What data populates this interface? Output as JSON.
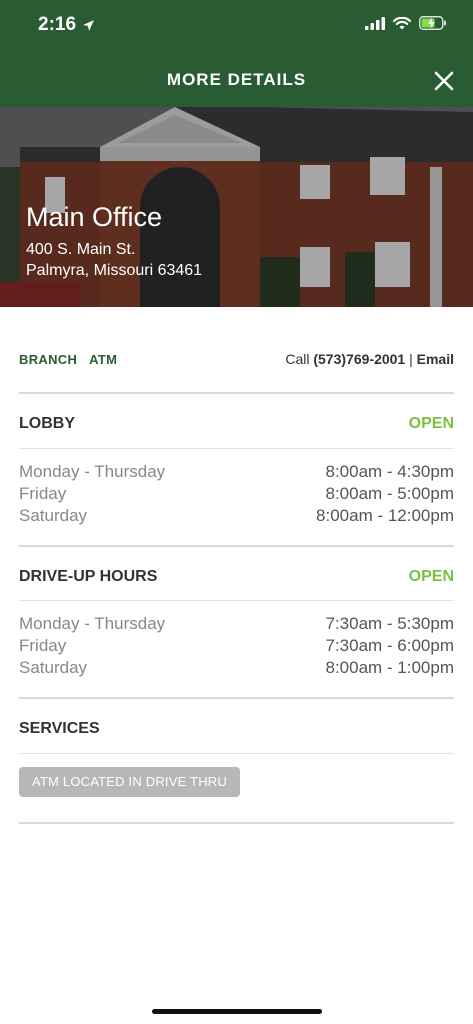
{
  "status": {
    "time": "2:16"
  },
  "nav": {
    "title": "MORE DETAILS"
  },
  "branch": {
    "name": "Main Office",
    "address_line1": "400 S. Main St.",
    "address_line2": "Palmyra, Missouri 63461"
  },
  "tabs": [
    "BRANCH",
    "ATM"
  ],
  "contact": {
    "call_label": "Call",
    "phone": "(573)769-2001",
    "separator": "|",
    "email_label": "Email"
  },
  "lobby": {
    "title": "LOBBY",
    "status": "OPEN",
    "rows": [
      {
        "days": "Monday - Thursday",
        "time": "8:00am - 4:30pm"
      },
      {
        "days": "Friday",
        "time": "8:00am - 5:00pm"
      },
      {
        "days": "Saturday",
        "time": "8:00am - 12:00pm"
      }
    ]
  },
  "drive_up": {
    "title": "DRIVE-UP HOURS",
    "status": "OPEN",
    "rows": [
      {
        "days": "Monday - Thursday",
        "time": "7:30am - 5:30pm"
      },
      {
        "days": "Friday",
        "time": "7:30am - 6:00pm"
      },
      {
        "days": "Saturday",
        "time": "8:00am - 1:00pm"
      }
    ]
  },
  "services": {
    "title": "SERVICES",
    "items": [
      "ATM LOCATED IN DRIVE THRU"
    ]
  },
  "colors": {
    "header_green": "#2a5c33",
    "open_green": "#7ac043",
    "tab_green": "#2a5c33"
  }
}
